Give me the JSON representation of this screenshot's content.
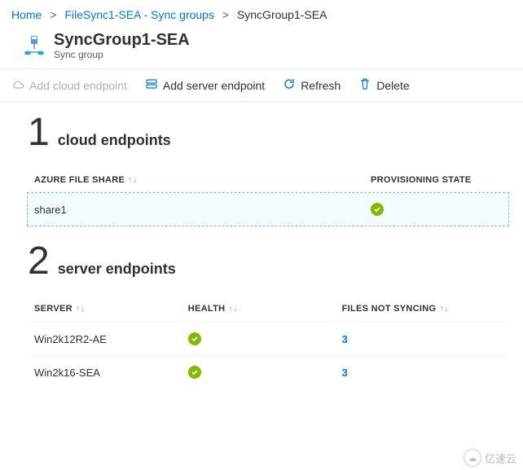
{
  "breadcrumb": {
    "home": "Home",
    "parent": "FileSync1-SEA - Sync groups",
    "current": "SyncGroup1-SEA"
  },
  "header": {
    "title": "SyncGroup1-SEA",
    "subtitle": "Sync group"
  },
  "toolbar": {
    "add_cloud": "Add cloud endpoint",
    "add_server": "Add server endpoint",
    "refresh": "Refresh",
    "delete": "Delete"
  },
  "cloud_section": {
    "count": "1",
    "label": "cloud endpoints",
    "col_share": "AZURE FILE SHARE",
    "col_state": "PROVISIONING STATE",
    "rows": [
      {
        "share": "share1",
        "state": "ok"
      }
    ]
  },
  "server_section": {
    "count": "2",
    "label": "server endpoints",
    "col_server": "SERVER",
    "col_health": "HEALTH",
    "col_files": "FILES NOT SYNCING",
    "rows": [
      {
        "server": "Win2k12R2-AE",
        "health": "ok",
        "files": "3"
      },
      {
        "server": "Win2k16-SEA",
        "health": "ok",
        "files": "3"
      }
    ]
  },
  "watermark": "亿速云"
}
